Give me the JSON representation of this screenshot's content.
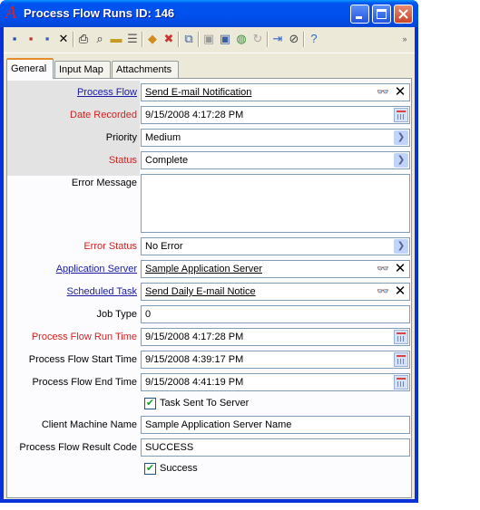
{
  "window": {
    "title": "Process Flow Runs ID: 146",
    "app_icon": "A"
  },
  "toolbar": {
    "icons": [
      "save-icon",
      "save-new-icon",
      "save-close-icon",
      "delete-icon",
      "print-icon",
      "find-icon",
      "open-folder-icon",
      "list-icon",
      "import-icon",
      "export-icon",
      "copy-icon",
      "paste-icon",
      "copy-record-icon",
      "globe-icon",
      "refresh-icon",
      "link-icon",
      "attach-icon",
      "help-icon"
    ]
  },
  "tabs": [
    {
      "label": "General"
    },
    {
      "label": "Input Map"
    },
    {
      "label": "Attachments"
    }
  ],
  "form": {
    "process_flow": {
      "label": "Process Flow",
      "value": "Send E-mail Notification"
    },
    "date_recorded": {
      "label": "Date Recorded",
      "value": "9/15/2008 4:17:28 PM"
    },
    "priority": {
      "label": "Priority",
      "value": "Medium"
    },
    "status": {
      "label": "Status",
      "value": "Complete"
    },
    "error_message": {
      "label": "Error Message",
      "value": ""
    },
    "error_status": {
      "label": "Error Status",
      "value": "No Error"
    },
    "application_server": {
      "label": "Application Server",
      "value": "Sample Application Server"
    },
    "scheduled_task": {
      "label": "Scheduled Task",
      "value": "Send Daily E-mail Notice"
    },
    "job_type": {
      "label": "Job Type",
      "value": "0"
    },
    "run_time": {
      "label": "Process Flow Run Time",
      "value": "9/15/2008 4:17:28 PM"
    },
    "start_time": {
      "label": "Process Flow Start Time",
      "value": "9/15/2008 4:39:17 PM"
    },
    "end_time": {
      "label": "Process Flow End Time",
      "value": "9/15/2008 4:41:19 PM"
    },
    "task_sent": {
      "label": "Task Sent To Server",
      "checked": true
    },
    "client_machine": {
      "label": "Client Machine Name",
      "value": "Sample Application Server Name"
    },
    "result_code": {
      "label": "Process Flow Result Code",
      "value": "SUCCESS"
    },
    "success": {
      "label": "Success",
      "checked": true
    }
  },
  "colors": {
    "required_label": "#d42020",
    "link_label": "#1a1aa6",
    "title_bar": "#0050ee"
  }
}
